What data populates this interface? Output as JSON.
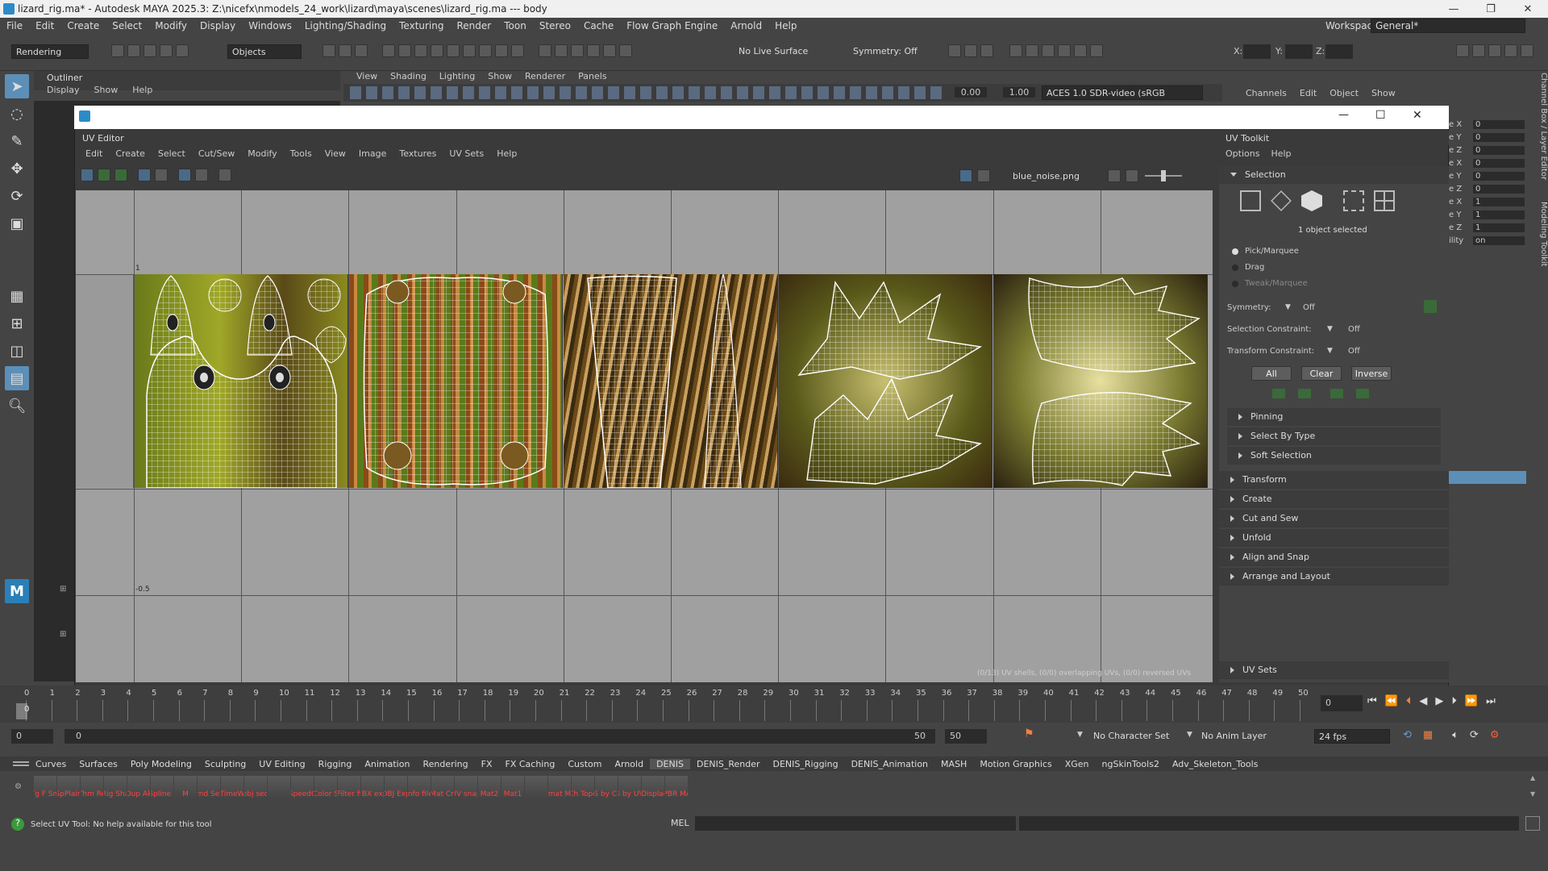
{
  "window": {
    "title": "lizard_rig.ma* - Autodesk MAYA 2025.3: Z:\\nicefx\\nmodels_24_work\\lizard\\maya\\scenes\\lizard_rig.ma  ---  body",
    "minimize": "—",
    "maximize": "❐",
    "close": "✕"
  },
  "menu": [
    "File",
    "Edit",
    "Create",
    "Select",
    "Modify",
    "Display",
    "Windows",
    "Lighting/Shading",
    "Texturing",
    "Render",
    "Toon",
    "Stereo",
    "Cache",
    "Flow Graph Engine",
    "Arnold",
    "Help"
  ],
  "workspace": {
    "label": "Workspace:",
    "value": "General*"
  },
  "status_line": {
    "mode": "Rendering",
    "objects": "Objects",
    "live": "No Live Surface",
    "symmetry": "Symmetry: Off",
    "x": "X:",
    "y": "Y:",
    "z": "Z:"
  },
  "outliner": {
    "title": "Outliner",
    "menu": [
      "Display",
      "Show",
      "Help"
    ]
  },
  "viewport": {
    "menu": [
      "View",
      "Shading",
      "Lighting",
      "Show",
      "Renderer",
      "Panels"
    ],
    "gamma": "0.00",
    "exposure": "1.00",
    "colorspace": "ACES 1.0 SDR-video (sRGB"
  },
  "channel_box": {
    "menu": [
      "Channels",
      "Edit",
      "Object",
      "Show"
    ],
    "rows": [
      {
        "label": "e X",
        "value": "0"
      },
      {
        "label": "e Y",
        "value": "0"
      },
      {
        "label": "e Z",
        "value": "0"
      },
      {
        "label": "e X",
        "value": "0"
      },
      {
        "label": "e Y",
        "value": "0"
      },
      {
        "label": "e Z",
        "value": "0"
      },
      {
        "label": "e X",
        "value": "1"
      },
      {
        "label": "e Y",
        "value": "1"
      },
      {
        "label": "e Z",
        "value": "1"
      },
      {
        "label": "ility",
        "value": "on"
      }
    ],
    "side_tabs": [
      "Channel Box / Layer Editor",
      "Modeling Toolkit"
    ]
  },
  "uv_editor": {
    "title": "UV Editor",
    "menu": [
      "Edit",
      "Create",
      "Select",
      "Cut/Sew",
      "Modify",
      "Tools",
      "View",
      "Image",
      "Textures",
      "UV Sets",
      "Help"
    ],
    "texture": "blue_noise.png",
    "axis_labels": {
      "one": "1",
      "minus_half": "-0.5"
    },
    "footer": "(0/13) UV shells, (0/0) overlapping UVs, (0/0) reversed UVs",
    "win_min": "—",
    "win_max": "☐",
    "win_close": "✕"
  },
  "uv_toolkit": {
    "title": "UV Toolkit",
    "menu": [
      "Options",
      "Help"
    ],
    "selection": {
      "title": "Selection",
      "status": "1 object selected",
      "modes": [
        "Pick/Marquee",
        "Drag",
        "Tweak/Marquee"
      ],
      "symmetry_label": "Symmetry:",
      "symmetry_value": "Off",
      "sel_constraint_label": "Selection Constraint:",
      "sel_constraint_value": "Off",
      "xf_constraint_label": "Transform Constraint:",
      "xf_constraint_value": "Off",
      "buttons": [
        "All",
        "Clear",
        "Inverse"
      ]
    },
    "subsections": [
      "Pinning",
      "Select By Type",
      "Soft Selection"
    ],
    "sections": [
      "Transform",
      "Create",
      "Cut and Sew",
      "Unfold",
      "Align and Snap",
      "Arrange and Layout"
    ],
    "uv_sets": "UV Sets"
  },
  "timeline": {
    "ticks": [
      "0",
      "1",
      "2",
      "3",
      "4",
      "5",
      "6",
      "7",
      "8",
      "9",
      "10",
      "11",
      "12",
      "13",
      "14",
      "15",
      "16",
      "17",
      "18",
      "19",
      "20",
      "21",
      "22",
      "23",
      "24",
      "25",
      "26",
      "27",
      "28",
      "29",
      "30",
      "31",
      "32",
      "33",
      "34",
      "35",
      "36",
      "37",
      "38",
      "39",
      "40",
      "41",
      "42",
      "43",
      "44",
      "45",
      "46",
      "47",
      "48",
      "49",
      "50"
    ],
    "current": "0",
    "start": "0",
    "end": "50"
  },
  "range": {
    "start": "0",
    "inner_start": "0",
    "inner_end": "50",
    "end": "50",
    "character_set": "No Character Set",
    "anim_layer": "No Anim Layer",
    "fps": "24 fps"
  },
  "shelf_tabs": [
    "Curves",
    "Surfaces",
    "Poly Modeling",
    "Sculpting",
    "UV Editing",
    "Rigging",
    "Animation",
    "Rendering",
    "FX",
    "FX Caching",
    "Custom",
    "Arnold",
    "DENIS",
    "DENIS_Render",
    "DENIS_Rigging",
    "DENIS_Animation",
    "MASH",
    "Motion Graphics",
    "XGen",
    "ngSkinTools2",
    "Adv_Skeleton_Tools"
  ],
  "shelf_icons": [
    "Tg F Sm",
    "SpPlain",
    "Thm Re",
    "Rig Sha",
    "Dup Ak",
    "Spline I",
    "M",
    "rnd Sel",
    "TimeW",
    "obj seq",
    "",
    "SpeedC",
    "Color S",
    "Filter fi",
    "FBX exp",
    "OBJ Exp",
    "Info file",
    "Mat Cn",
    "UV snap",
    "Mat2",
    "Mat1",
    "",
    "mat M",
    "Ch Topo",
    "S by Cl",
    "S by UV",
    "Arnold Displacement",
    "APBR MAT"
  ],
  "status_bar": {
    "help": "Select UV Tool: No help available for this tool",
    "mel": "MEL"
  },
  "colors": {
    "accent": "#5c8fb8",
    "selected_row": "#4a7fa8",
    "background": "#444444"
  }
}
